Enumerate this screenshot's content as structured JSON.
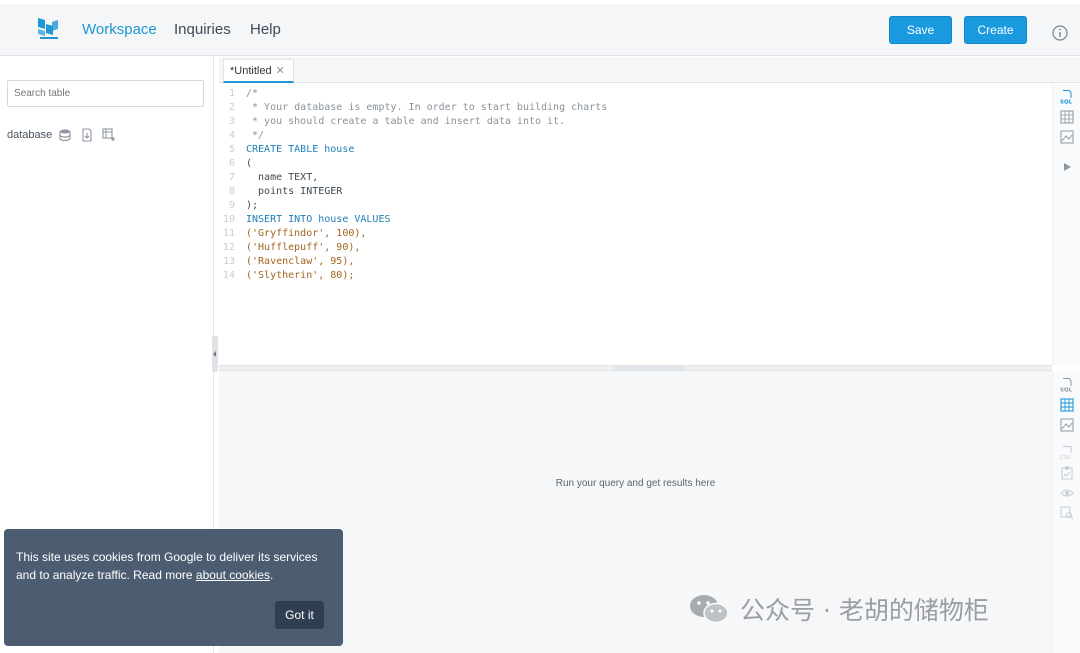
{
  "header": {
    "nav": [
      "Workspace",
      "Inquiries",
      "Help"
    ],
    "save_label": "Save",
    "create_label": "Create",
    "accent_color": "#1a9be0"
  },
  "sidebar": {
    "search_placeholder": "Search table",
    "database_label": "database"
  },
  "tabs": [
    {
      "label": "*Untitled",
      "close_icon": "close-icon"
    }
  ],
  "editor": {
    "lines": [
      "/*",
      " * Your database is empty. In order to start building charts",
      " * you should create a table and insert data into it.",
      " */",
      "CREATE TABLE house",
      "(",
      "  name TEXT,",
      "  points INTEGER",
      ");",
      "INSERT INTO house VALUES",
      "('Gryffindor', 100),",
      "('Hufflepuff', 90),",
      "('Ravenclaw', 95),",
      "('Slytherin', 80);"
    ]
  },
  "results": {
    "empty_message": "Run your query and get results here"
  },
  "cookie": {
    "text": "This site uses cookies from Google to deliver its services and to analyze traffic. Read more ",
    "link": "about cookies",
    "after_link": ".",
    "button": "Got it"
  },
  "watermark": {
    "text": "公众号 · 老胡的储物柜"
  }
}
